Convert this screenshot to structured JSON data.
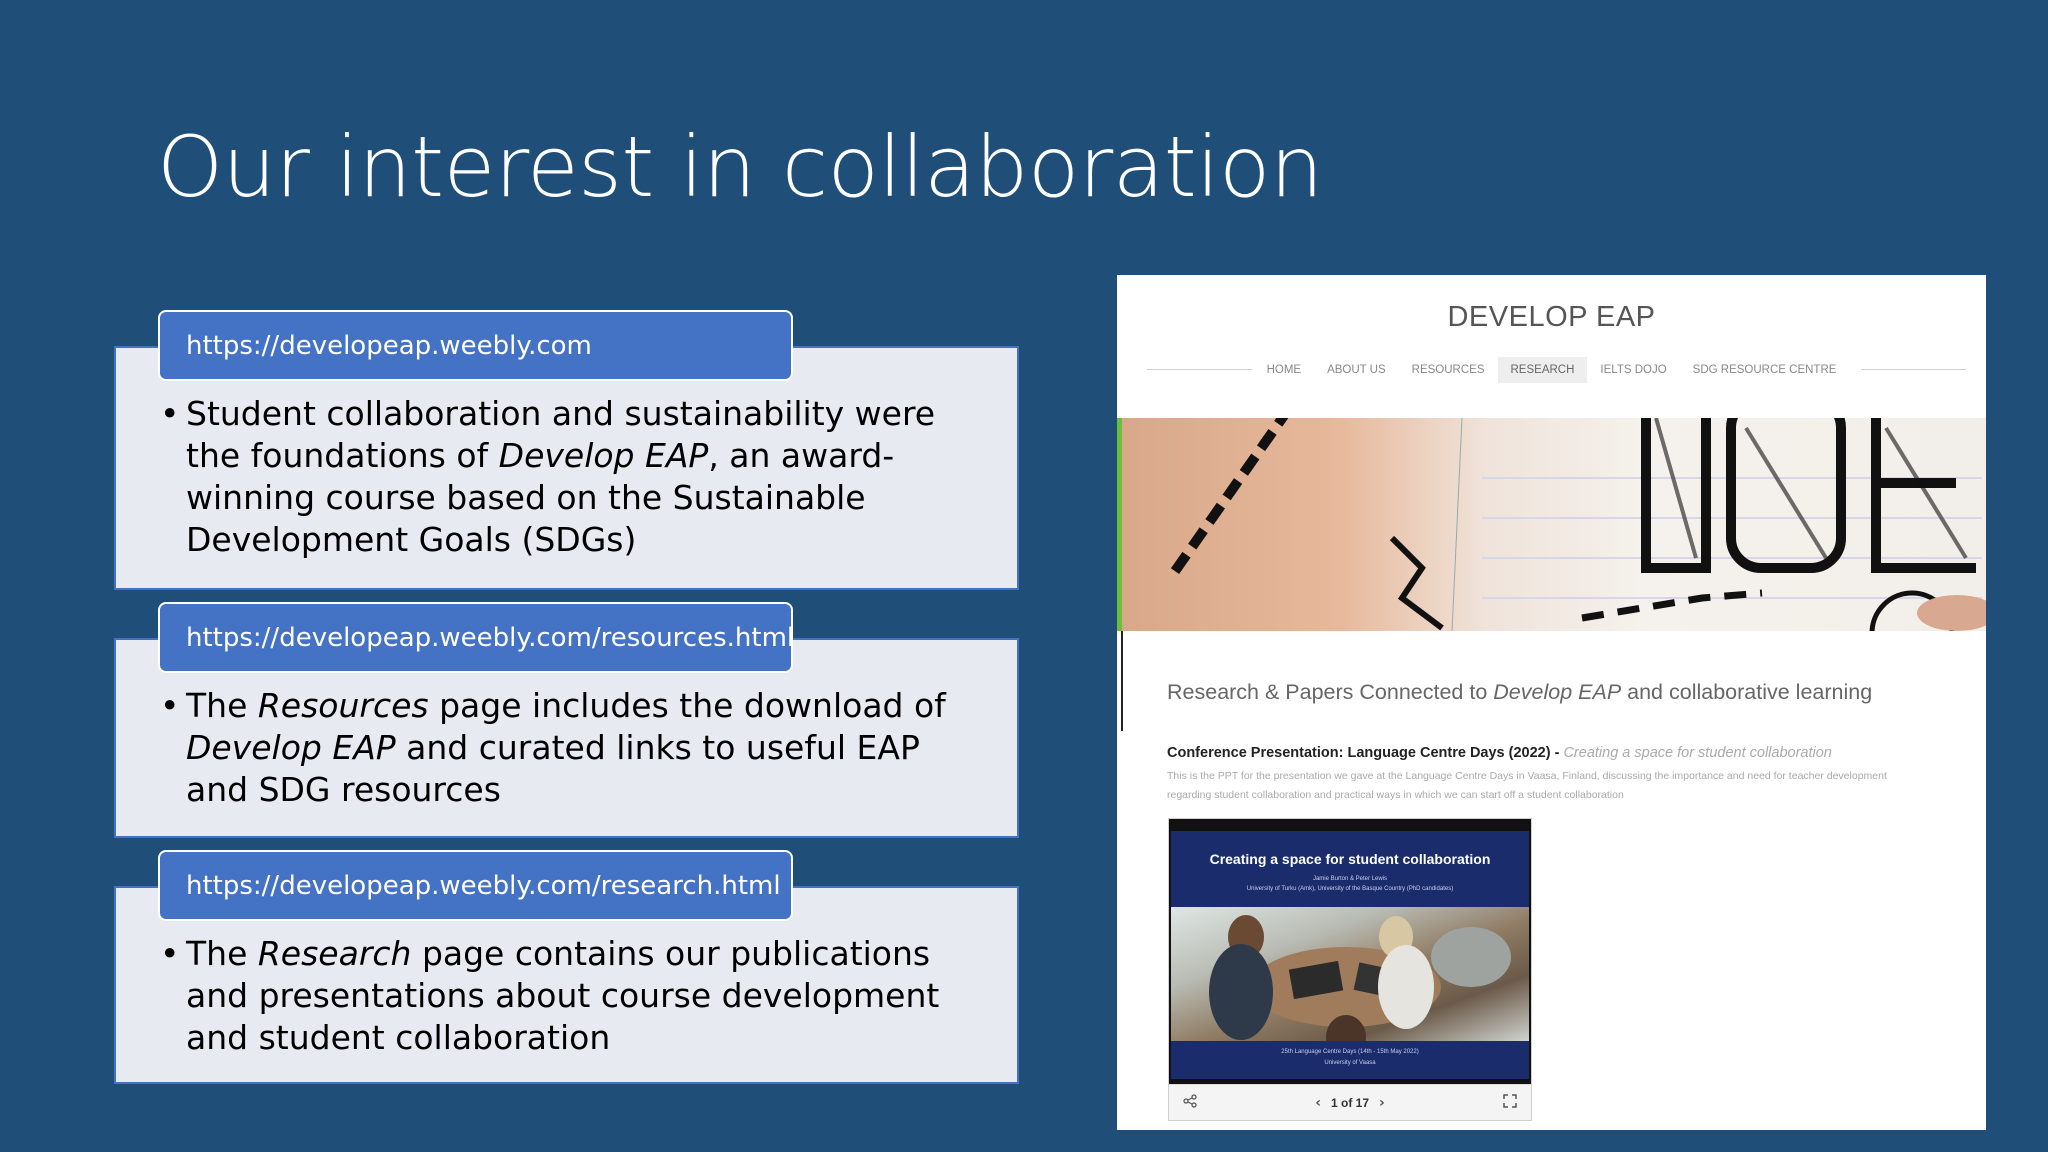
{
  "title": "Our interest in collaboration",
  "cards": [
    {
      "url": "https://developeap.weebly.com",
      "text_a": "Student collaboration and sustainability were the foundations of ",
      "text_em": "Develop EAP",
      "text_b": ", an award-winning course based on the Sustainable Development Goals (SDGs)"
    },
    {
      "url": "https://developeap.weebly.com/resources.html",
      "text_a": "The ",
      "text_em": "Resources",
      "text_b": " page includes the download of ",
      "text_em2": "Develop EAP",
      "text_c": " and curated links to useful EAP and SDG resources"
    },
    {
      "url": "https://developeap.weebly.com/research.html",
      "text_a": "The ",
      "text_em": "Research",
      "text_b": " page contains our publications and presentations about course development and student collaboration"
    }
  ],
  "website": {
    "title": "DEVELOP EAP",
    "nav": [
      "HOME",
      "ABOUT US",
      "RESOURCES",
      "RESEARCH",
      "IELTS DOJO",
      "SDG RESOURCE CENTRE"
    ],
    "active_nav": "RESEARCH",
    "heading_a": "Research & Papers Connected to ",
    "heading_em": "Develop EAP",
    "heading_b": " and collaborative learning",
    "conf_bold": "Conference Presentation: Language Centre Days (2022) - ",
    "conf_em": "Creating a space for student collaboration",
    "conf_desc": "This is the PPT for the presentation we gave at the Language Centre Days in Vaasa, Finland, discussing the importance and need for teacher development regarding student collaboration and practical ways in which we can start off a student collaboration",
    "viewer": {
      "slide_title": "Creating a space for student collaboration",
      "slide_authors": "Jamie Burton & Peter Lewis",
      "slide_affil": "University of Turku (Amk), University of the Basque Country (PhD candidates)",
      "slide_footer_1": "25th Language Centre Days (14th - 15th May 2022)",
      "slide_footer_2": "University of Vaasa",
      "page_indicator": "1 of 17"
    }
  },
  "colors": {
    "background": "#1f4e79",
    "card_head": "#4472c4",
    "card_body": "#e8eaf1"
  }
}
